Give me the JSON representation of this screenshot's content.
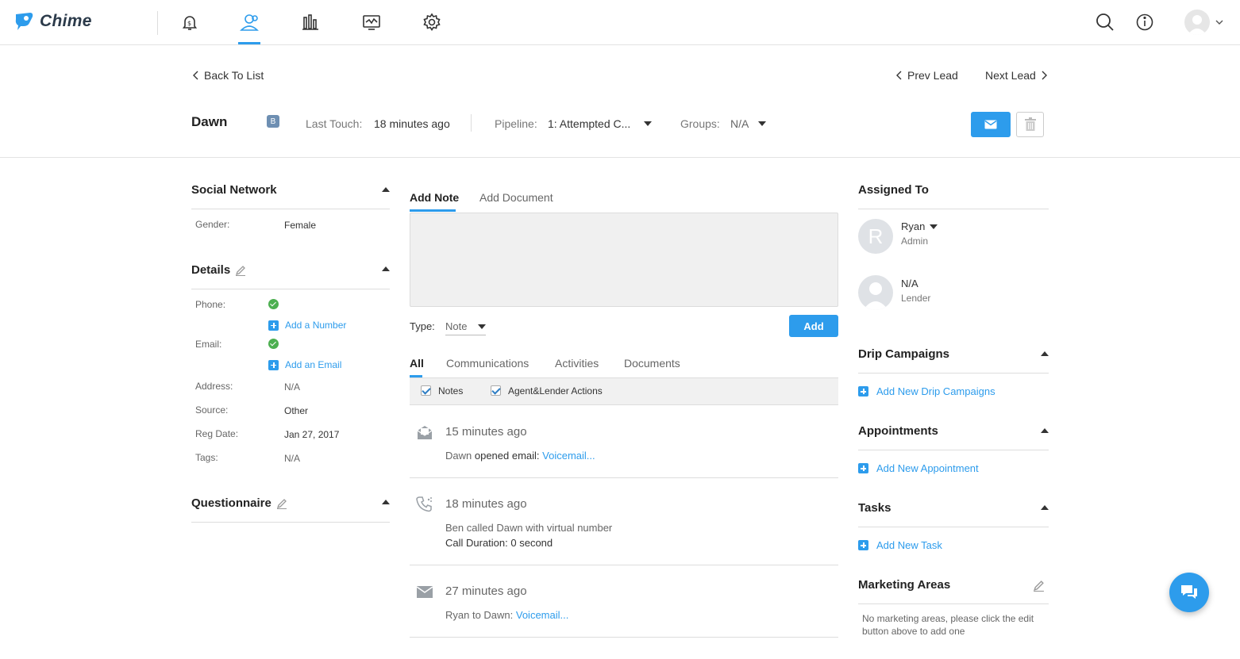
{
  "app": {
    "name": "Chime"
  },
  "nav": {
    "icons": [
      "dollar-bell-icon",
      "leads-icon",
      "bar-chart-icon",
      "monitor-chart-icon",
      "gear-icon"
    ],
    "right_icons": [
      "search-icon",
      "info-icon",
      "user-avatar-icon"
    ]
  },
  "header": {
    "back_label": "Back To List",
    "prev_label": "Prev Lead",
    "next_label": "Next Lead",
    "lead_name": "Dawn",
    "badge": "B",
    "last_touch_label": "Last Touch:",
    "last_touch_value": "18 minutes ago",
    "pipeline_label": "Pipeline:",
    "pipeline_value": "1: Attempted C...",
    "groups_label": "Groups:",
    "groups_value": "N/A"
  },
  "left": {
    "social": {
      "title": "Social Network",
      "gender_label": "Gender:",
      "gender_value": "Female"
    },
    "details": {
      "title": "Details",
      "phone_label": "Phone:",
      "add_number": "Add a Number",
      "email_label": "Email:",
      "add_email": "Add an Email",
      "address_label": "Address:",
      "address_value": "N/A",
      "source_label": "Source:",
      "source_value": "Other",
      "regdate_label": "Reg Date:",
      "regdate_value": "Jan 27, 2017",
      "tags_label": "Tags:",
      "tags_value": "N/A"
    },
    "questionnaire": {
      "title": "Questionnaire"
    }
  },
  "middle": {
    "tabs": {
      "add_note": "Add Note",
      "add_document": "Add Document"
    },
    "type_label": "Type:",
    "type_value": "Note",
    "add_button": "Add",
    "feed_tabs": {
      "all": "All",
      "communications": "Communications",
      "activities": "Activities",
      "documents": "Documents"
    },
    "filters": {
      "notes": "Notes",
      "agent_lender": "Agent&Lender Actions"
    },
    "feed": [
      {
        "icon": "email-open-icon",
        "time": "15 minutes ago",
        "actor": "Dawn",
        "action": " opened email: ",
        "link": "Voicemail..."
      },
      {
        "icon": "phone-icon",
        "time": "18 minutes ago",
        "line1": "Ben called Dawn with virtual number",
        "line2": "Call Duration: 0 second"
      },
      {
        "icon": "envelope-icon",
        "time": "27 minutes ago",
        "prefix": "Ryan to Dawn: ",
        "link": "Voicemail..."
      }
    ]
  },
  "right": {
    "assigned": {
      "title": "Assigned To",
      "person1_initial": "R",
      "person1_name": "Ryan",
      "person1_role": "Admin",
      "person2_name": "N/A",
      "person2_role": "Lender"
    },
    "drip": {
      "title": "Drip Campaigns",
      "add": "Add New Drip Campaigns"
    },
    "appointments": {
      "title": "Appointments",
      "add": "Add New Appointment"
    },
    "tasks": {
      "title": "Tasks",
      "add": "Add New Task"
    },
    "marketing": {
      "title": "Marketing Areas",
      "empty_line1": "No marketing areas, please click the edit",
      "empty_line2": "button above to add one"
    }
  },
  "colors": {
    "accent": "#2d9cec",
    "success": "#4caf50"
  }
}
